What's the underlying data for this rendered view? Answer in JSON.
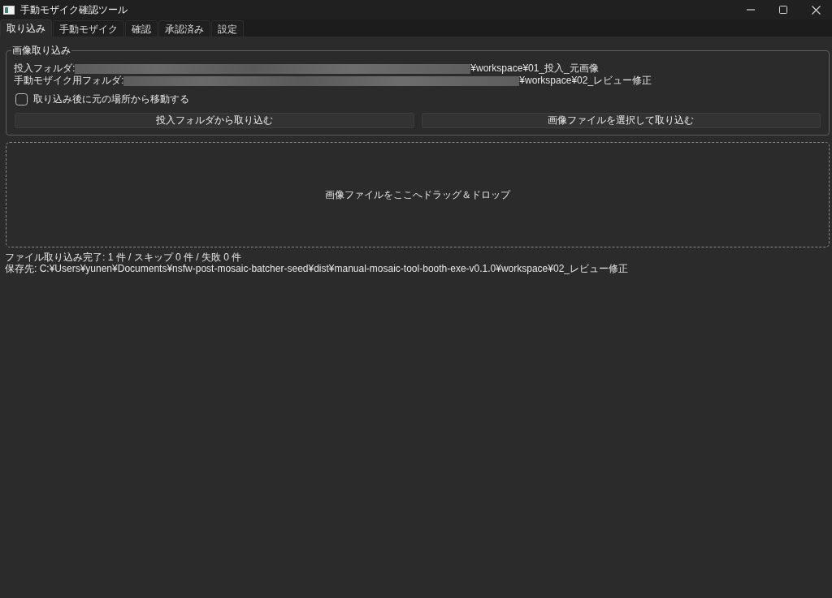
{
  "window": {
    "title": "手動モザイク確認ツール"
  },
  "tabs": [
    {
      "label": "取り込み",
      "selected": true
    },
    {
      "label": "手動モザイク",
      "selected": false
    },
    {
      "label": "確認",
      "selected": false
    },
    {
      "label": "承認済み",
      "selected": false
    },
    {
      "label": "設定",
      "selected": false
    }
  ],
  "import_group": {
    "title": "画像取り込み",
    "folders": [
      {
        "label": "投入フォルダ:",
        "redacted": true,
        "path_end": "¥workspace¥01_投入_元画像"
      },
      {
        "label": "手動モザイク用フォルダ:",
        "redacted": true,
        "path_end": "¥workspace¥02_レビュー修正"
      }
    ],
    "move_after_import": {
      "label": "取り込み後に元の場所から移動する",
      "checked": false
    },
    "buttons": [
      "投入フォルダから取り込む",
      "画像ファイルを選択して取り込む"
    ]
  },
  "drop_zone": {
    "text": "画像ファイルをここへドラッグ＆ドロップ"
  },
  "status": [
    "ファイル取り込み完了: 1 件 / スキップ 0 件 / 失敗 0 件",
    "保存先: C:¥Users¥yunen¥Documents¥nsfw-post-mosaic-batcher-seed¥dist¥manual-mosaic-tool-booth-exe-v0.1.0¥workspace¥02_レビュー修正"
  ]
}
